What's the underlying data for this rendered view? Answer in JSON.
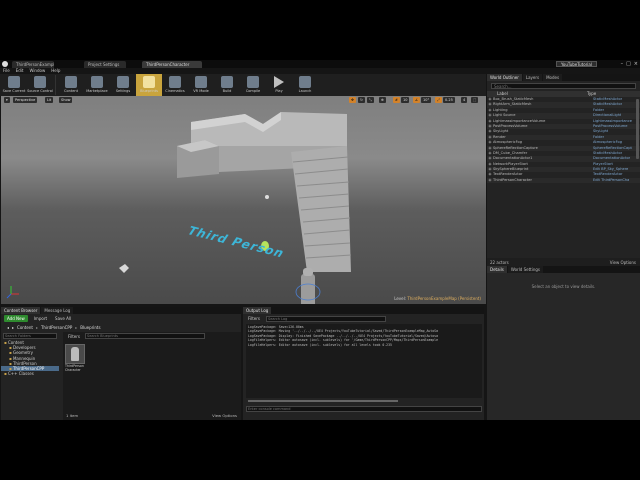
{
  "window": {
    "title": "YouTubeTutorial",
    "tabs": [
      "ThirdPersonExampleMap",
      "Project Settings",
      "ThirdPersonCharacter"
    ],
    "controls": [
      "minimize-icon",
      "maximize-icon",
      "close-icon"
    ]
  },
  "menu": [
    "File",
    "Edit",
    "Window",
    "Help"
  ],
  "toolbar": [
    {
      "label": "Save Current",
      "icon": "save-icon"
    },
    {
      "label": "Source Control",
      "icon": "source-control-icon"
    },
    {
      "label": "Content",
      "icon": "content-icon"
    },
    {
      "label": "Marketplace",
      "icon": "marketplace-icon"
    },
    {
      "label": "Settings",
      "icon": "settings-icon"
    },
    {
      "label": "Blueprints",
      "icon": "blueprints-icon"
    },
    {
      "label": "Cinematics",
      "icon": "cinematics-icon"
    },
    {
      "label": "VR Mode",
      "icon": "vr-mode-icon"
    },
    {
      "label": "Build",
      "icon": "build-icon"
    },
    {
      "label": "Compile",
      "icon": "compile-icon"
    },
    {
      "label": "Play",
      "icon": "play-icon"
    },
    {
      "label": "Launch",
      "icon": "launch-icon"
    }
  ],
  "viewport": {
    "perspective": "Perspective",
    "lit": "Lit",
    "show": "Show",
    "grid_value": "10",
    "angle_value": "10°",
    "scale_value": "0.25",
    "cam_speed": "4",
    "world_text": "Third Person",
    "status_prefix": "Level:",
    "status_level": "ThirdPersonExampleMap (Persistent)"
  },
  "outliner": {
    "tabs": [
      "World Outliner",
      "Layers",
      "Modes"
    ],
    "search_placeholder": "Search...",
    "col_label": "Label",
    "col_type": "Type",
    "rows": [
      {
        "name": "Box_Brush_StaticMesh",
        "type": "StaticMeshActor"
      },
      {
        "name": "RightArm_StaticMesh",
        "type": "StaticMeshActor"
      },
      {
        "name": "Lighting",
        "type": "Folder"
      },
      {
        "name": "Light Source",
        "type": "DirectionalLight"
      },
      {
        "name": "LightmassImportanceVolume",
        "type": "LightmassImportance"
      },
      {
        "name": "PostProcessVolume",
        "type": "PostProcessVolume"
      },
      {
        "name": "SkyLight",
        "type": "SkyLight"
      },
      {
        "name": "Render",
        "type": "Folder"
      },
      {
        "name": "AtmosphericFog",
        "type": "AtmosphericFog"
      },
      {
        "name": "SphereReflectionCapture",
        "type": "SphereReflectionCapt"
      },
      {
        "name": "DM_Cube_Chamfer",
        "type": "StaticMeshActor"
      },
      {
        "name": "DocumentationActor1",
        "type": "DocumentationActor"
      },
      {
        "name": "NetworkPlayerStart",
        "type": "PlayerStart"
      },
      {
        "name": "SkySphereBlueprint",
        "type": "Edit BP_Sky_Sphere"
      },
      {
        "name": "TextRenderActor",
        "type": "TextRenderActor"
      },
      {
        "name": "ThirdPersonCharacter",
        "type": "Edit ThirdPersonCha"
      }
    ],
    "actor_count": "22 actors",
    "view_options": "View Options"
  },
  "details": {
    "tabs": [
      "Details",
      "World Settings"
    ],
    "hint": "Select an object to view details."
  },
  "content_browser": {
    "tabs": [
      "Content Browser",
      "Message Log"
    ],
    "add_new": "Add New",
    "import": "Import",
    "save_all": "Save All",
    "path": [
      "Content",
      "ThirdPersonCPP",
      "Blueprints"
    ],
    "folder_search": "Search Folders",
    "asset_search": "Search Blueprints",
    "filters": "Filters",
    "tree": [
      {
        "name": "Content",
        "level": 0
      },
      {
        "name": "Developers",
        "level": 1
      },
      {
        "name": "Geometry",
        "level": 1
      },
      {
        "name": "Mannequin",
        "level": 1
      },
      {
        "name": "ThirdPerson",
        "level": 1
      },
      {
        "name": "ThirdPersonCPP",
        "level": 1,
        "selected": true
      },
      {
        "name": "C++ Classes",
        "level": 0
      }
    ],
    "asset_name": "ThirdPerson Character",
    "asset_count": "1 item",
    "view_options": "View Options"
  },
  "output_log": {
    "tab": "Output Log",
    "filters": "Filters",
    "search_placeholder": "Search Log",
    "lines": [
      "LogSavePackage: Save=126.00ms",
      "LogSavePackage: Moving '../../../../UE4 Projects/YouTubeTutorial/Saved/ThirdPersonExampleMap_AutoSa",
      "LogSavePackage: Display: Finished SavePackage ../../../../UE4 Projects/YouTubeTutorial/Saved/Autosa",
      "LogFileHelpers: Editor autosave (incl. sublevels) for '/Game/ThirdPersonCPP/Maps/ThirdPersonExample",
      "LogFileHelpers: Editor autosave (incl. sublevels) for all levels took 0.235"
    ],
    "console_placeholder": "Enter console command"
  }
}
